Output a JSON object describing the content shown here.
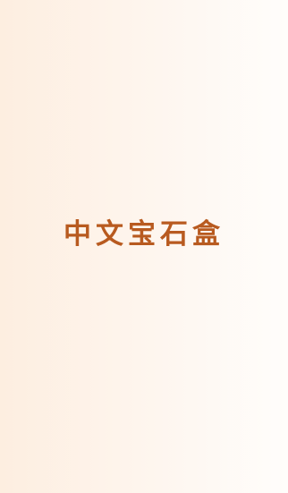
{
  "splash": {
    "app_title": "中文宝石盒"
  },
  "colors": {
    "background_start": "#fdeee0",
    "background_end": "#fffdfb",
    "title_color": "#b85a1f"
  }
}
